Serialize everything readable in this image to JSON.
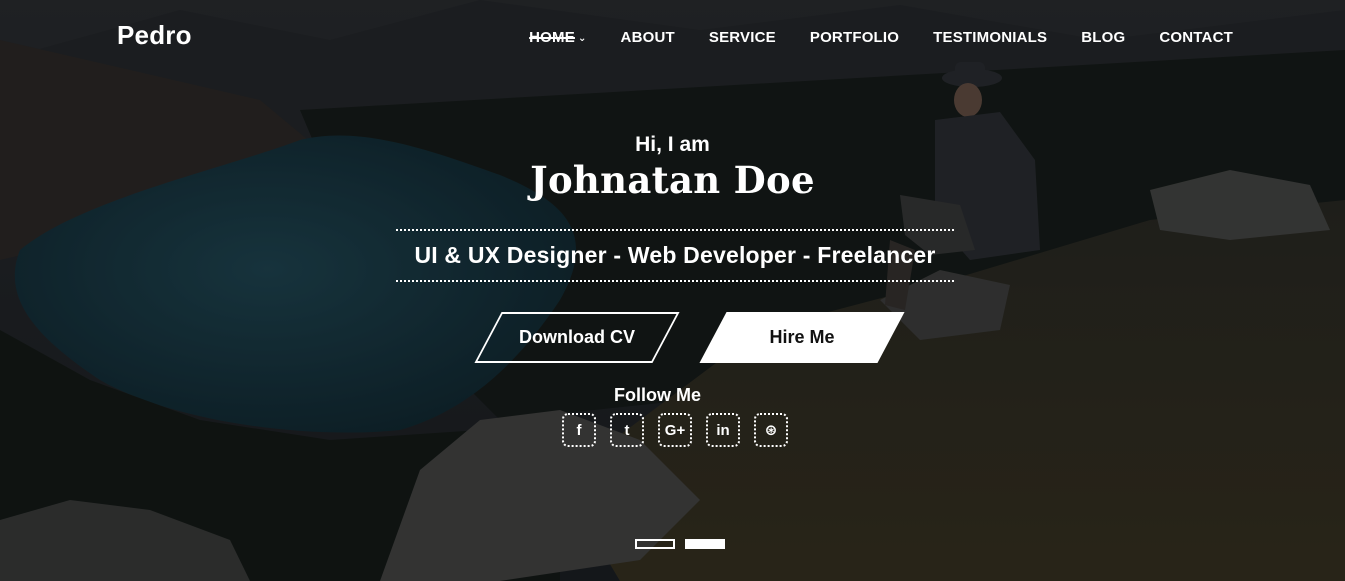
{
  "brand": "Pedro",
  "nav": {
    "items": [
      {
        "label": "HOME",
        "active": true
      },
      {
        "label": "ABOUT"
      },
      {
        "label": "SERVICE"
      },
      {
        "label": "PORTFOLIO"
      },
      {
        "label": "TESTIMONIALS"
      },
      {
        "label": "BLOG"
      },
      {
        "label": "CONTACT"
      }
    ],
    "home_chevron": "chevron-down-icon"
  },
  "hero": {
    "intro": "Hi, I am",
    "name": "Johnatan Doe",
    "tagline": "UI & UX Designer - Web Developer - Freelancer",
    "download_cv": "Download CV",
    "hire_me": "Hire Me",
    "follow_me": "Follow Me"
  },
  "socials": [
    {
      "icon": "facebook-icon",
      "glyph": "f"
    },
    {
      "icon": "twitter-icon",
      "glyph": "t"
    },
    {
      "icon": "google-plus-icon",
      "glyph": "G+"
    },
    {
      "icon": "linkedin-icon",
      "glyph": "in"
    },
    {
      "icon": "dribbble-icon",
      "glyph": "⊛"
    }
  ],
  "slider": {
    "slide_count": 2,
    "active_index": 1
  },
  "colors": {
    "text": "#ffffff",
    "overlay": "#0b0d0f",
    "hire_button_text": "#111111"
  }
}
